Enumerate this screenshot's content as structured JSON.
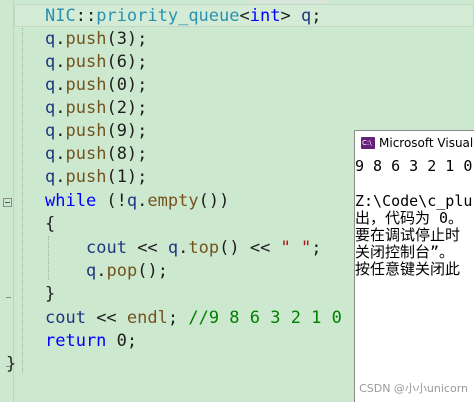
{
  "editor": {
    "lines": [
      {
        "tokens": [
          {
            "t": "NIC",
            "c": "type"
          },
          {
            "t": "::",
            "c": "plain"
          },
          {
            "t": "priority_queue",
            "c": "type"
          },
          {
            "t": "<",
            "c": "plain"
          },
          {
            "t": "int",
            "c": "kw"
          },
          {
            "t": "> ",
            "c": "plain"
          },
          {
            "t": "q",
            "c": "var"
          },
          {
            "t": ";",
            "c": "plain"
          }
        ]
      },
      {
        "tokens": [
          {
            "t": "q",
            "c": "var"
          },
          {
            "t": ".",
            "c": "plain"
          },
          {
            "t": "push",
            "c": "fn"
          },
          {
            "t": "(3);",
            "c": "plain"
          }
        ]
      },
      {
        "tokens": [
          {
            "t": "q",
            "c": "var"
          },
          {
            "t": ".",
            "c": "plain"
          },
          {
            "t": "push",
            "c": "fn"
          },
          {
            "t": "(6);",
            "c": "plain"
          }
        ]
      },
      {
        "tokens": [
          {
            "t": "q",
            "c": "var"
          },
          {
            "t": ".",
            "c": "plain"
          },
          {
            "t": "push",
            "c": "fn"
          },
          {
            "t": "(0);",
            "c": "plain"
          }
        ]
      },
      {
        "tokens": [
          {
            "t": "q",
            "c": "var"
          },
          {
            "t": ".",
            "c": "plain"
          },
          {
            "t": "push",
            "c": "fn"
          },
          {
            "t": "(2);",
            "c": "plain"
          }
        ]
      },
      {
        "tokens": [
          {
            "t": "q",
            "c": "var"
          },
          {
            "t": ".",
            "c": "plain"
          },
          {
            "t": "push",
            "c": "fn"
          },
          {
            "t": "(9);",
            "c": "plain"
          }
        ]
      },
      {
        "tokens": [
          {
            "t": "q",
            "c": "var"
          },
          {
            "t": ".",
            "c": "plain"
          },
          {
            "t": "push",
            "c": "fn"
          },
          {
            "t": "(8);",
            "c": "plain"
          }
        ]
      },
      {
        "tokens": [
          {
            "t": "q",
            "c": "var"
          },
          {
            "t": ".",
            "c": "plain"
          },
          {
            "t": "push",
            "c": "fn"
          },
          {
            "t": "(1);",
            "c": "plain"
          }
        ]
      },
      {
        "tokens": [
          {
            "t": "while",
            "c": "kw"
          },
          {
            "t": " (!",
            "c": "plain"
          },
          {
            "t": "q",
            "c": "var"
          },
          {
            "t": ".",
            "c": "plain"
          },
          {
            "t": "empty",
            "c": "fn"
          },
          {
            "t": "())",
            "c": "plain"
          }
        ]
      },
      {
        "tokens": [
          {
            "t": "{",
            "c": "plain"
          }
        ]
      },
      {
        "tokens": [
          {
            "t": "cout",
            "c": "var"
          },
          {
            "t": " << ",
            "c": "plain"
          },
          {
            "t": "q",
            "c": "var"
          },
          {
            "t": ".",
            "c": "plain"
          },
          {
            "t": "top",
            "c": "fn"
          },
          {
            "t": "() << ",
            "c": "plain"
          },
          {
            "t": "\" \"",
            "c": "str"
          },
          {
            "t": ";",
            "c": "plain"
          }
        ]
      },
      {
        "tokens": [
          {
            "t": "q",
            "c": "var"
          },
          {
            "t": ".",
            "c": "plain"
          },
          {
            "t": "pop",
            "c": "fn"
          },
          {
            "t": "();",
            "c": "plain"
          }
        ]
      },
      {
        "tokens": [
          {
            "t": "}",
            "c": "plain"
          }
        ]
      },
      {
        "tokens": [
          {
            "t": "cout",
            "c": "var"
          },
          {
            "t": " << ",
            "c": "plain"
          },
          {
            "t": "endl",
            "c": "fn"
          },
          {
            "t": "; ",
            "c": "plain"
          },
          {
            "t": "//9 8 6 3 2 1 0",
            "c": "cmt"
          }
        ]
      },
      {
        "tokens": [
          {
            "t": "return",
            "c": "kw"
          },
          {
            "t": " 0;",
            "c": "plain"
          }
        ]
      },
      {
        "tokens": [
          {
            "t": "}",
            "c": "plain"
          }
        ]
      }
    ]
  },
  "console": {
    "title": "Microsoft Visual St",
    "icon": "C:\\",
    "lines": [
      "9 8 6 3 2 1 0",
      "",
      "Z:\\Code\\c_plu",
      "出，代码为 0。",
      "要在调试停止时",
      "关闭控制台”。",
      "按任意键关闭此"
    ]
  },
  "watermark": "CSDN @小小unicorn"
}
